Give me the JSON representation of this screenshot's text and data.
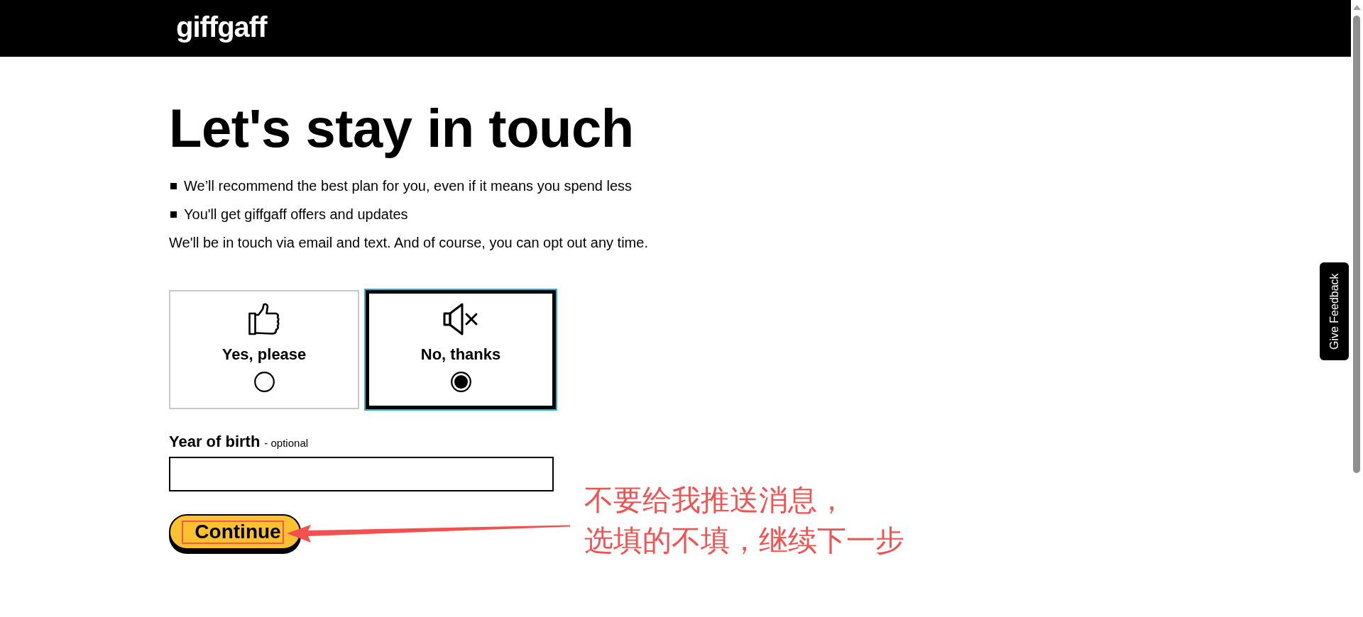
{
  "header": {
    "logo": "giffgaff"
  },
  "heading": "Let's stay in touch",
  "bullets": [
    "We’ll recommend the best plan for you, even if it means you spend less",
    "You'll get giffgaff offers and updates"
  ],
  "note": "We'll be in touch via email and text. And of course, you can opt out any time.",
  "options": [
    {
      "kind": "accept",
      "label": "Yes, please",
      "selected": false
    },
    {
      "kind": "decline",
      "label": "No, thanks",
      "selected": true
    }
  ],
  "year_of_birth": {
    "label": "Year of birth",
    "hint": "- optional"
  },
  "continue_button": {
    "label": "Continue"
  },
  "feedback_tab": {
    "label": "Give Feedback"
  },
  "annotation": {
    "lines": [
      "不要给我推送消息，",
      "选填的不填，继续下一步"
    ]
  }
}
